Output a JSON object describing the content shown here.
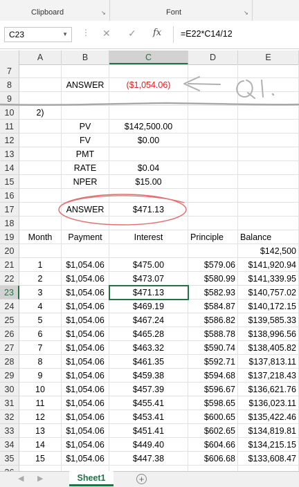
{
  "ribbon": {
    "group1": "Clipboard",
    "group2": "Font"
  },
  "formula_bar": {
    "name_box": "C23",
    "formula": "=E22*C14/12",
    "fx_label": "fx",
    "cancel_icon": "✕",
    "enter_icon": "✓"
  },
  "columns": [
    "A",
    "B",
    "C",
    "D",
    "E"
  ],
  "selected_column": "C",
  "selected_row": "23",
  "rows": [
    {
      "n": "7",
      "cells": [
        "",
        "",
        "",
        "",
        ""
      ]
    },
    {
      "n": "8",
      "cells": [
        "",
        "ANSWER",
        "($1,054.06)",
        "",
        ""
      ]
    },
    {
      "n": "9",
      "cells": [
        "",
        "",
        "",
        "",
        ""
      ]
    },
    {
      "n": "10",
      "cells": [
        "2)",
        "",
        "",
        "",
        ""
      ]
    },
    {
      "n": "11",
      "cells": [
        "",
        "PV",
        "$142,500.00",
        "",
        ""
      ]
    },
    {
      "n": "12",
      "cells": [
        "",
        "FV",
        "$0.00",
        "",
        ""
      ]
    },
    {
      "n": "13",
      "cells": [
        "",
        "PMT",
        "",
        "",
        ""
      ]
    },
    {
      "n": "14",
      "cells": [
        "",
        "RATE",
        "$0.04",
        "",
        ""
      ]
    },
    {
      "n": "15",
      "cells": [
        "",
        "NPER",
        "$15.00",
        "",
        ""
      ]
    },
    {
      "n": "16",
      "cells": [
        "",
        "",
        "",
        "",
        ""
      ]
    },
    {
      "n": "17",
      "cells": [
        "",
        "ANSWER",
        "$471.13",
        "",
        ""
      ]
    },
    {
      "n": "18",
      "cells": [
        "",
        "",
        "",
        "",
        ""
      ]
    },
    {
      "n": "19",
      "cells": [
        "Month",
        "Payment",
        "Interest",
        "Principle",
        "Balance"
      ]
    },
    {
      "n": "20",
      "cells": [
        "",
        "",
        "",
        "",
        "$142,500"
      ]
    },
    {
      "n": "21",
      "cells": [
        "1",
        "$1,054.06",
        "$475.00",
        "$579.06",
        "$141,920.94"
      ]
    },
    {
      "n": "22",
      "cells": [
        "2",
        "$1,054.06",
        "$473.07",
        "$580.99",
        "$141,339.95"
      ]
    },
    {
      "n": "23",
      "cells": [
        "3",
        "$1,054.06",
        "$471.13",
        "$582.93",
        "$140,757.02"
      ]
    },
    {
      "n": "24",
      "cells": [
        "4",
        "$1,054.06",
        "$469.19",
        "$584.87",
        "$140,172.15"
      ]
    },
    {
      "n": "25",
      "cells": [
        "5",
        "$1,054.06",
        "$467.24",
        "$586.82",
        "$139,585.33"
      ]
    },
    {
      "n": "26",
      "cells": [
        "6",
        "$1,054.06",
        "$465.28",
        "$588.78",
        "$138,996.56"
      ]
    },
    {
      "n": "27",
      "cells": [
        "7",
        "$1,054.06",
        "$463.32",
        "$590.74",
        "$138,405.82"
      ]
    },
    {
      "n": "28",
      "cells": [
        "8",
        "$1,054.06",
        "$461.35",
        "$592.71",
        "$137,813.11"
      ]
    },
    {
      "n": "29",
      "cells": [
        "9",
        "$1,054.06",
        "$459.38",
        "$594.68",
        "$137,218.43"
      ]
    },
    {
      "n": "30",
      "cells": [
        "10",
        "$1,054.06",
        "$457.39",
        "$596.67",
        "$136,621.76"
      ]
    },
    {
      "n": "31",
      "cells": [
        "11",
        "$1,054.06",
        "$455.41",
        "$598.65",
        "$136,023.11"
      ]
    },
    {
      "n": "32",
      "cells": [
        "12",
        "$1,054.06",
        "$453.41",
        "$600.65",
        "$135,422.46"
      ]
    },
    {
      "n": "33",
      "cells": [
        "13",
        "$1,054.06",
        "$451.41",
        "$602.65",
        "$134,819.81"
      ]
    },
    {
      "n": "34",
      "cells": [
        "14",
        "$1,054.06",
        "$449.40",
        "$604.66",
        "$134,215.15"
      ]
    },
    {
      "n": "35",
      "cells": [
        "15",
        "$1,054.06",
        "$447.38",
        "$606.68",
        "$133,608.47"
      ]
    },
    {
      "n": "36",
      "cells": [
        "",
        "",
        "",
        "",
        ""
      ]
    }
  ],
  "annotation": {
    "text": "Q1.",
    "color": "#b0b0b0",
    "circle_color": "#e07070"
  },
  "sheet_tabs": {
    "active": "Sheet1",
    "add_icon": "plus-icon"
  },
  "colors": {
    "accent": "#217346",
    "negative": "#e02020"
  }
}
